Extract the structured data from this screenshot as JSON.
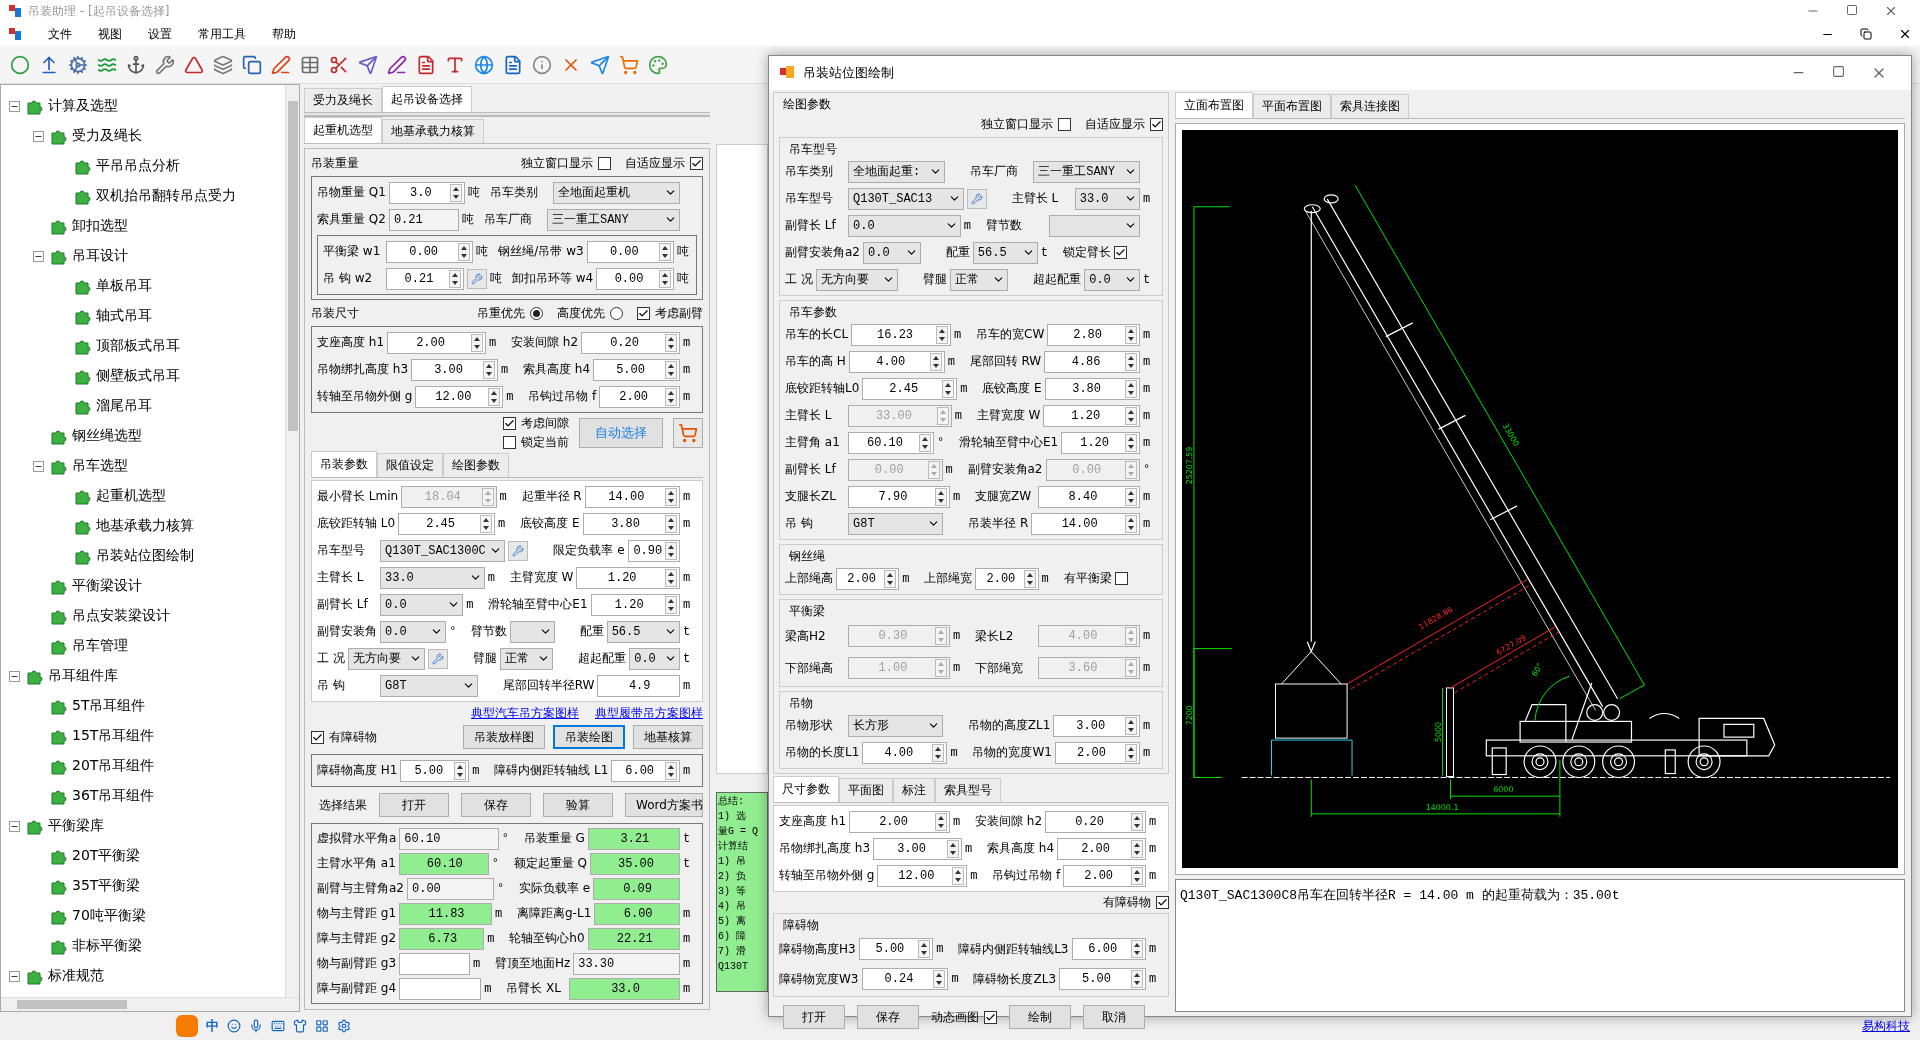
{
  "app": {
    "title": "吊装助理 - [起吊设备选择]"
  },
  "menu": [
    "文件",
    "视图",
    "设置",
    "常用工具",
    "帮助"
  ],
  "tree": [
    {
      "label": "计算及选型",
      "expanded": true,
      "children": [
        {
          "label": "受力及绳长",
          "expanded": true,
          "children": [
            {
              "label": "平吊吊点分析"
            },
            {
              "label": "双机抬吊翻转吊点受力"
            }
          ]
        },
        {
          "label": "卸扣选型"
        },
        {
          "label": "吊耳设计",
          "expanded": true,
          "children": [
            {
              "label": "单板吊耳"
            },
            {
              "label": "轴式吊耳"
            },
            {
              "label": "顶部板式吊耳"
            },
            {
              "label": "侧壁板式吊耳"
            },
            {
              "label": "溜尾吊耳"
            }
          ]
        },
        {
          "label": "钢丝绳选型"
        },
        {
          "label": "吊车选型",
          "expanded": true,
          "children": [
            {
              "label": "起重机选型"
            },
            {
              "label": "地基承载力核算"
            },
            {
              "label": "吊装站位图绘制"
            }
          ]
        },
        {
          "label": "平衡梁设计"
        },
        {
          "label": "吊点安装梁设计"
        },
        {
          "label": "吊车管理"
        }
      ]
    },
    {
      "label": "吊耳组件库",
      "expanded": true,
      "children": [
        {
          "label": "5T吊耳组件"
        },
        {
          "label": "15T吊耳组件"
        },
        {
          "label": "20T吊耳组件"
        },
        {
          "label": "36T吊耳组件"
        }
      ]
    },
    {
      "label": "平衡梁库",
      "expanded": true,
      "children": [
        {
          "label": "20T平衡梁"
        },
        {
          "label": "35T平衡梁"
        },
        {
          "label": "70吨平衡梁"
        },
        {
          "label": "非标平衡梁"
        }
      ]
    },
    {
      "label": "标准规范",
      "expanded": true
    }
  ],
  "main_tabs": [
    {
      "label": "受力及绳长",
      "selected": false
    },
    {
      "label": "起吊设备选择",
      "selected": true
    }
  ],
  "sub_tabs": [
    {
      "label": "起重机选型",
      "selected": true
    },
    {
      "label": "地基承载力核算",
      "selected": false
    }
  ],
  "weight_group": {
    "title": "吊装重量",
    "options": [
      {
        "kind": "check",
        "label": "独立窗口显示",
        "checked": false
      },
      {
        "kind": "check",
        "label": "自适应显示",
        "checked": true
      }
    ],
    "rows": [
      [
        {
          "label": "吊物重量 Q1",
          "field": {
            "kind": "spin",
            "value": "3.0"
          },
          "unit": "吨"
        },
        {
          "label": "吊车类别",
          "field": {
            "kind": "select",
            "value": "全地面起重机"
          }
        }
      ],
      [
        {
          "label": "索具重量 Q2",
          "field": {
            "kind": "text",
            "value": "0.21",
            "readonly": true
          },
          "unit": "吨"
        },
        {
          "label": "吊车厂商",
          "field": {
            "kind": "select",
            "value": "三一重工SANY"
          }
        }
      ]
    ],
    "inner_rows": [
      [
        {
          "label": "平衡梁 w1",
          "field": {
            "kind": "spin",
            "value": "0.00"
          },
          "unit": "吨"
        },
        {
          "label": "钢丝绳/吊带 w3",
          "field": {
            "kind": "spin",
            "value": "0.00"
          },
          "unit": "吨"
        }
      ],
      [
        {
          "label": "吊 钩 w2",
          "field": {
            "kind": "spin",
            "value": "0.21",
            "tool": true
          },
          "unit": "吨"
        },
        {
          "label": "卸扣吊环等 w4",
          "field": {
            "kind": "spin",
            "value": "0.00"
          },
          "unit": "吨"
        }
      ]
    ]
  },
  "size_group": {
    "title": "吊装尺寸",
    "options": [
      {
        "kind": "radio",
        "label": "吊重优先",
        "selected": true
      },
      {
        "kind": "radio",
        "label": "高度优先",
        "selected": false
      },
      {
        "kind": "check",
        "label": "考虑副臂",
        "checked": true
      }
    ],
    "rows": [
      [
        {
          "label": "支座高度 h1",
          "field": {
            "kind": "spin",
            "value": "2.00"
          },
          "unit": "m"
        },
        {
          "label": "安装间隙 h2",
          "field": {
            "kind": "spin",
            "value": "0.20"
          },
          "unit": "m"
        }
      ],
      [
        {
          "label": "吊物绑扎高度 h3",
          "field": {
            "kind": "spin",
            "value": "3.00"
          },
          "unit": "m"
        },
        {
          "label": "索具高度 h4",
          "field": {
            "kind": "spin",
            "value": "5.00"
          },
          "unit": "m"
        }
      ],
      [
        {
          "label": "转轴至吊物外侧 g",
          "field": {
            "kind": "spin",
            "value": "12.00"
          },
          "unit": "m"
        },
        {
          "label": "吊钩过吊物 f",
          "field": {
            "kind": "spin",
            "value": "2.00"
          },
          "unit": "m"
        }
      ]
    ]
  },
  "auto_select": {
    "checks": [
      {
        "label": "考虑间隙",
        "checked": true
      },
      {
        "label": "锁定当前",
        "checked": false
      }
    ],
    "button": "自动选择"
  },
  "param_tabs": [
    {
      "label": "吊装参数",
      "selected": true
    },
    {
      "label": "限值设定",
      "selected": false
    },
    {
      "label": "绘图参数",
      "selected": false
    }
  ],
  "param_rows": [
    [
      {
        "label": "最小臂长 Lmin",
        "field": {
          "kind": "spin",
          "value": "18.04",
          "disabled": true
        },
        "unit": "m"
      },
      {
        "label": "起重半径 R",
        "field": {
          "kind": "spin",
          "value": "14.00"
        },
        "unit": "m"
      }
    ],
    [
      {
        "label": "底铰距转轴 L0",
        "field": {
          "kind": "spin",
          "value": "2.45"
        },
        "unit": "m"
      },
      {
        "label": "底铰高度 E",
        "field": {
          "kind": "spin",
          "value": "3.80"
        },
        "unit": "m"
      }
    ],
    [
      {
        "label": "吊车型号",
        "field": {
          "kind": "select",
          "value": "Q130T_SAC1300C",
          "tool": true
        }
      },
      {
        "label": "限定负载率 e",
        "field": {
          "kind": "spin",
          "value": "0.90"
        }
      }
    ],
    [
      {
        "label": "主臂长 L",
        "field": {
          "kind": "select",
          "value": "33.0"
        },
        "unit": "m"
      },
      {
        "label": "主臂宽度 W",
        "field": {
          "kind": "spin",
          "value": "1.20"
        },
        "unit": "m"
      }
    ],
    [
      {
        "label": "副臂长 Lf",
        "field": {
          "kind": "select",
          "value": "0.0"
        },
        "unit": "m"
      },
      {
        "label": "滑轮轴至臂中心E1",
        "field": {
          "kind": "spin",
          "value": "1.20"
        },
        "unit": "m"
      }
    ],
    [
      {
        "label": "副臂安装角",
        "field": {
          "kind": "select",
          "value": "0.0"
        },
        "unit": "°"
      },
      {
        "label": "臂节数",
        "field": {
          "kind": "select"
        }
      },
      {
        "label": "配重",
        "field": {
          "kind": "select",
          "value": "56.5"
        },
        "unit": "t"
      }
    ],
    [
      {
        "label": "工 况",
        "field": {
          "kind": "select",
          "value": "无方向要",
          "tool": true
        }
      },
      {
        "label": "臂腿",
        "field": {
          "kind": "select",
          "value": "正常"
        }
      },
      {
        "label": "超起配重",
        "field": {
          "kind": "select",
          "value": "0.0"
        },
        "unit": "t"
      }
    ],
    [
      {
        "label": "吊 钩",
        "field": {
          "kind": "select",
          "value": "G8T"
        }
      },
      {
        "label": "尾部回转半径RW",
        "field": {
          "kind": "text",
          "value": "4.9"
        },
        "unit": "m"
      }
    ]
  ],
  "links": [
    "典型汽车吊方案图样",
    "典型履带吊方案图样"
  ],
  "obstacle_check": {
    "label": "有障碍物",
    "checked": true
  },
  "draw_buttons": [
    {
      "label": "吊装放样图",
      "selected": false
    },
    {
      "label": "吊装绘图",
      "selected": true
    },
    {
      "label": "地基核算",
      "selected": false
    }
  ],
  "obstacle_rows": [
    [
      {
        "label": "障碍物高度 H1",
        "field": {
          "kind": "spin",
          "value": "5.00"
        },
        "unit": "m"
      },
      {
        "label": "障碍内侧距转轴线 L1",
        "field": {
          "kind": "spin",
          "value": "6.00"
        },
        "unit": "m"
      }
    ]
  ],
  "result_label": "选择结果",
  "result_buttons": [
    "打开",
    "保存",
    "验算",
    "Word方案书"
  ],
  "result_rows": [
    [
      {
        "label": "虚拟臂水平角a",
        "field": {
          "kind": "text",
          "value": "60.10",
          "readonly": true
        },
        "unit": "°"
      },
      {
        "label": "吊装重量 G",
        "field": {
          "kind": "text",
          "value": "3.21",
          "highlight": true
        },
        "unit": "t"
      }
    ],
    [
      {
        "label": "主臂水平角 a1",
        "field": {
          "kind": "text",
          "value": "60.10",
          "highlight": true
        },
        "unit": "°"
      },
      {
        "label": "额定起重量 Q",
        "field": {
          "kind": "text",
          "value": "35.00",
          "highlight": true
        },
        "unit": "t"
      }
    ],
    [
      {
        "label": "副臂与主臂角a2",
        "field": {
          "kind": "text",
          "value": "0.00",
          "readonly": true
        },
        "unit": "°"
      },
      {
        "label": "实际负载率 e",
        "field": {
          "kind": "text",
          "value": "0.09",
          "highlight": true
        }
      }
    ],
    [
      {
        "label": "物与主臂距 g1",
        "field": {
          "kind": "text",
          "value": "11.83",
          "highlight": true
        },
        "unit": "m"
      },
      {
        "label": "离障距离g-L1",
        "field": {
          "kind": "text",
          "value": "6.00",
          "highlight": true
        },
        "unit": "m"
      }
    ],
    [
      {
        "label": "障与主臂距 g2",
        "field": {
          "kind": "text",
          "value": "6.73",
          "highlight": true
        },
        "unit": "m"
      },
      {
        "label": "轮轴至钩心h0",
        "field": {
          "kind": "text",
          "value": "22.21",
          "highlight": true
        },
        "unit": "m"
      }
    ],
    [
      {
        "label": "物与副臂距 g3",
        "field": {
          "kind": "text"
        },
        "unit": "m"
      },
      {
        "label": "臂顶至地面Hz",
        "field": {
          "kind": "text",
          "value": "33.30",
          "readonly": true
        },
        "unit": "m"
      }
    ],
    [
      {
        "label": "障与副臂距 g4",
        "field": {
          "kind": "text"
        },
        "unit": "m"
      },
      {
        "label": "吊臂长 XL",
        "field": {
          "kind": "text",
          "value": "33.0",
          "highlight": true
        },
        "unit": "m"
      }
    ]
  ],
  "summary_lines": [
    "总结:",
    "1) 选",
    "量G = Q",
    "计算结",
    "1) 吊",
    "2) 负",
    "3) 等",
    "4) 吊",
    "5) 离",
    "6) 障",
    "7) 滑",
    "Q130T"
  ],
  "dialog": {
    "title": "吊装站位图绘制",
    "form_title": "绘图参数",
    "options": [
      {
        "kind": "check",
        "label": "独立窗口显示",
        "checked": false
      },
      {
        "kind": "check",
        "label": "自适应显示",
        "checked": true
      }
    ],
    "groups": [
      {
        "title": "吊车型号",
        "rows": [
          [
            {
              "label": "吊车类别",
              "field": {
                "kind": "select",
                "value": "全地面起重:"
              }
            },
            {
              "label": "吊车厂商",
              "field": {
                "kind": "select",
                "value": "三一重工SANY"
              }
            }
          ],
          [
            {
              "label": "吊车型号",
              "field": {
                "kind": "select",
                "value": "Q130T_SAC13",
                "tool": true
              }
            },
            {
              "label": "主臂长 L",
              "field": {
                "kind": "select",
                "value": "33.0"
              },
              "unit": "m"
            }
          ],
          [
            {
              "label": "副臂长 Lf",
              "field": {
                "kind": "select",
                "value": "0.0"
              },
              "unit": "m"
            },
            {
              "label": "臂节数",
              "field": {
                "kind": "select"
              }
            }
          ],
          [
            {
              "label": "副臂安装角a2",
              "field": {
                "kind": "select",
                "value": "0.0"
              }
            },
            {
              "label": "配重",
              "field": {
                "kind": "select",
                "value": "56.5"
              },
              "unit": "t"
            },
            {
              "label": "锁定臂长",
              "field": {
                "kind": "check",
                "checked": true
              }
            }
          ],
          [
            {
              "label": "工 况",
              "field": {
                "kind": "select",
                "value": "无方向要"
              }
            },
            {
              "label": "臂腿",
              "field": {
                "kind": "select",
                "value": "正常"
              }
            },
            {
              "label": "超起配重",
              "field": {
                "kind": "select",
                "value": "0.0"
              },
              "unit": "t"
            }
          ]
        ]
      },
      {
        "title": "吊车参数",
        "rows": [
          [
            {
              "label": "吊车的长CL",
              "field": {
                "kind": "spin",
                "value": "16.23"
              },
              "unit": "m"
            },
            {
              "label": "吊车的宽CW",
              "field": {
                "kind": "spin",
                "value": "2.80"
              },
              "unit": "m"
            }
          ],
          [
            {
              "label": "吊车的高 H",
              "field": {
                "kind": "spin",
                "value": "4.00"
              },
              "unit": "m"
            },
            {
              "label": "尾部回转 RW",
              "field": {
                "kind": "spin",
                "value": "4.86"
              },
              "unit": "m"
            }
          ],
          [
            {
              "label": "底铰距转轴L0",
              "field": {
                "kind": "spin",
                "value": "2.45"
              },
              "unit": "m"
            },
            {
              "label": "底铰高度 E",
              "field": {
                "kind": "spin",
                "value": "3.80"
              },
              "unit": "m"
            }
          ],
          [
            {
              "label": "主臂长 L",
              "field": {
                "kind": "spin",
                "value": "33.00",
                "disabled": true
              },
              "unit": "m"
            },
            {
              "label": "主臂宽度 W",
              "field": {
                "kind": "spin",
                "value": "1.20"
              },
              "unit": "m"
            }
          ],
          [
            {
              "label": "主臂角 a1",
              "field": {
                "kind": "spin",
                "value": "60.10"
              },
              "unit": "°"
            },
            {
              "label": "滑轮轴至臂中心E1",
              "field": {
                "kind": "spin",
                "value": "1.20"
              },
              "unit": "m"
            }
          ],
          [
            {
              "label": "副臂长 Lf",
              "field": {
                "kind": "spin",
                "value": "0.00",
                "disabled": true
              },
              "unit": "m"
            },
            {
              "label": "副臂安装角a2",
              "field": {
                "kind": "spin",
                "value": "0.00",
                "disabled": true
              },
              "unit": "°"
            }
          ],
          [
            {
              "label": "支腿长ZL",
              "field": {
                "kind": "spin",
                "value": "7.90"
              },
              "unit": "m"
            },
            {
              "label": "支腿宽ZW",
              "field": {
                "kind": "spin",
                "value": "8.40"
              },
              "unit": "m"
            }
          ],
          [
            {
              "label": "吊 钩",
              "field": {
                "kind": "select",
                "value": "G8T"
              }
            },
            {
              "label": "吊装半径 R",
              "field": {
                "kind": "spin",
                "value": "14.00"
              },
              "unit": "m"
            }
          ]
        ]
      },
      {
        "title": "钢丝绳",
        "rows": [
          [
            {
              "label": "上部绳高",
              "field": {
                "kind": "spin",
                "value": "2.00"
              },
              "unit": "m"
            },
            {
              "label": "上部绳宽",
              "field": {
                "kind": "spin",
                "value": "2.00"
              },
              "unit": "m"
            },
            {
              "label": "有平衡梁",
              "field": {
                "kind": "check",
                "checked": false
              }
            }
          ]
        ]
      },
      {
        "title": "平衡梁",
        "rows": [
          [
            {
              "label": "梁高H2",
              "field": {
                "kind": "spin",
                "value": "0.30",
                "disabled": true
              },
              "unit": "m"
            },
            {
              "label": "梁长L2",
              "field": {
                "kind": "spin",
                "value": "4.00",
                "disabled": true
              },
              "unit": "m"
            }
          ],
          [
            {
              "label": "下部绳高",
              "field": {
                "kind": "spin",
                "value": "1.00",
                "disabled": true
              },
              "unit": "m"
            },
            {
              "label": "下部绳宽",
              "field": {
                "kind": "spin",
                "value": "3.60",
                "disabled": true
              },
              "unit": "m"
            }
          ]
        ]
      },
      {
        "title": "吊物",
        "rows": [
          [
            {
              "label": "吊物形状",
              "field": {
                "kind": "select",
                "value": "长方形"
              }
            },
            {
              "label": "吊物的高度ZL1",
              "field": {
                "kind": "spin",
                "value": "3.00"
              },
              "unit": "m"
            }
          ],
          [
            {
              "label": "吊物的长度L1",
              "field": {
                "kind": "spin",
                "value": "4.00"
              },
              "unit": "m"
            },
            {
              "label": "吊物的宽度W1",
              "field": {
                "kind": "spin",
                "value": "2.00"
              },
              "unit": "m"
            }
          ]
        ]
      }
    ],
    "tabs": [
      {
        "label": "尺寸参数",
        "selected": true
      },
      {
        "label": "平面图",
        "selected": false
      },
      {
        "label": "标注",
        "selected": false
      },
      {
        "label": "索具型号",
        "selected": false
      }
    ],
    "tab_rows": [
      [
        {
          "label": "支座高度 h1",
          "field": {
            "kind": "spin",
            "value": "2.00"
          },
          "unit": "m"
        },
        {
          "label": "安装间隙 h2",
          "field": {
            "kind": "spin",
            "value": "0.20"
          },
          "unit": "m"
        }
      ],
      [
        {
          "label": "吊物绑扎高度 h3",
          "field": {
            "kind": "spin",
            "value": "3.00"
          },
          "unit": "m"
        },
        {
          "label": "索具高度 h4",
          "field": {
            "kind": "spin",
            "value": "2.00"
          },
          "unit": "m"
        }
      ],
      [
        {
          "label": "转轴至吊物外侧 g",
          "field": {
            "kind": "spin",
            "value": "12.00"
          },
          "unit": "m"
        },
        {
          "label": "吊钩过吊物 f",
          "field": {
            "kind": "spin",
            "value": "2.00"
          },
          "unit": "m"
        }
      ]
    ],
    "obstacle_check": {
      "label": "有障碍物",
      "checked": true
    },
    "obstacle_group": {
      "title": "障碍物",
      "rows": [
        [
          {
            "label": "障碍物高度H3",
            "field": {
              "kind": "spin",
              "value": "5.00"
            },
            "unit": "m"
          },
          {
            "label": "障碍内侧距转轴线L3",
            "field": {
              "kind": "spin",
              "value": "6.00"
            },
            "unit": "m"
          }
        ],
        [
          {
            "label": "障碍物宽度W3",
            "field": {
              "kind": "spin",
              "value": "0.24"
            },
            "unit": "m"
          },
          {
            "label": "障碍物长度ZL3",
            "field": {
              "kind": "spin",
              "value": "5.00"
            },
            "unit": "m"
          }
        ]
      ]
    },
    "footer": [
      {
        "kind": "button",
        "label": "打开"
      },
      {
        "kind": "button",
        "label": "保存"
      },
      {
        "kind": "check",
        "label": "动态画图",
        "checked": true
      },
      {
        "kind": "button",
        "label": "绘制"
      },
      {
        "kind": "button",
        "label": "取消"
      }
    ],
    "view_tabs": [
      {
        "label": "立面布置图",
        "selected": true
      },
      {
        "label": "平面布置图",
        "selected": false
      },
      {
        "label": "索具连接图",
        "selected": false
      }
    ],
    "drawing_labels": [
      "25207.59",
      "33000",
      "11828.86",
      "6727.09",
      "60°",
      "7200",
      "5000",
      "6000",
      "14000.1"
    ],
    "output": "Q130T_SAC1300C8吊车在回转半径R = 14.00 m 的起重荷载为：35.00t"
  },
  "ime": {
    "mode": "中"
  },
  "footer_link": "易构科技"
}
